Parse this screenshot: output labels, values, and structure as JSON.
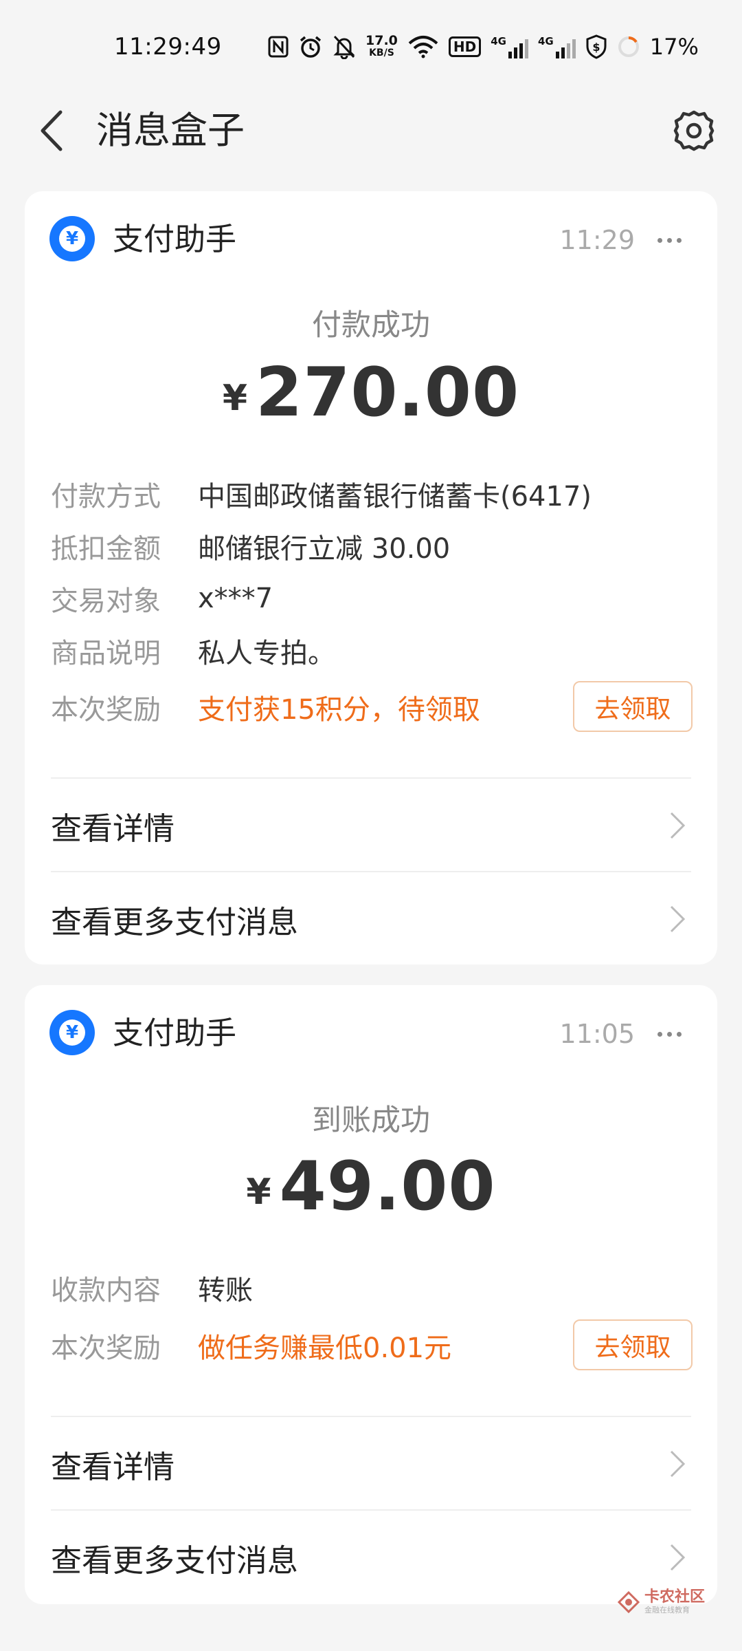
{
  "status_bar": {
    "time": "11:29:49",
    "net_speed_value": "17.0",
    "net_speed_unit": "KB/S",
    "hd_label": "HD",
    "sim1_label": "4G",
    "sim2_label": "4G",
    "battery_percent": "17%",
    "icons": [
      "nfc-icon",
      "alarm-icon",
      "mute-icon",
      "wifi-icon",
      "hd-icon",
      "signal-icon",
      "signal-icon",
      "shield-icon",
      "battery-icon"
    ]
  },
  "header": {
    "title": "消息盒子",
    "back_icon": "back-arrow-icon",
    "settings_icon": "gear-icon"
  },
  "messages": [
    {
      "app_name": "支付助手",
      "app_icon_glyph": "¥",
      "time": "11:29",
      "status": "付款成功",
      "currency": "¥",
      "amount": "270.00",
      "details": [
        {
          "label": "付款方式",
          "value": "中国邮政储蓄银行储蓄卡(6417)"
        },
        {
          "label": "抵扣金额",
          "value": "邮储银行立减 30.00"
        },
        {
          "label": "交易对象",
          "value": "x***7"
        },
        {
          "label": "商品说明",
          "value": "私人专拍。"
        }
      ],
      "reward": {
        "label": "本次奖励",
        "value": "支付获15积分，待领取",
        "button": "去领取"
      },
      "links": [
        "查看详情",
        "查看更多支付消息"
      ]
    },
    {
      "app_name": "支付助手",
      "app_icon_glyph": "¥",
      "time": "11:05",
      "status": "到账成功",
      "currency": "¥",
      "amount": "49.00",
      "details": [
        {
          "label": "收款内容",
          "value": "转账"
        }
      ],
      "reward": {
        "label": "本次奖励",
        "value": "做任务赚最低0.01元",
        "button": "去领取"
      },
      "links": [
        "查看详情",
        "查看更多支付消息"
      ]
    }
  ],
  "watermark": {
    "main": "卡农社区",
    "sub": "金融在线教育"
  },
  "colors": {
    "background": "#f5f5f5",
    "card": "#ffffff",
    "accent_blue": "#1677ff",
    "reward_orange": "#ef6c1a"
  }
}
